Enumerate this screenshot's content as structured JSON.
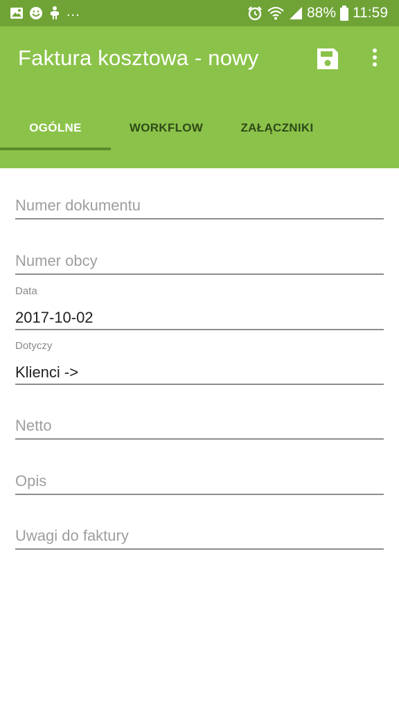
{
  "status_bar": {
    "left_icons": [
      "image-icon",
      "smiley-icon",
      "android-icon"
    ],
    "more": "...",
    "battery_percent": "88%",
    "time": "11:59"
  },
  "app_bar": {
    "title": "Faktura kosztowa - nowy",
    "color": "#8bc34a"
  },
  "tabs": [
    {
      "label": "OGÓLNE",
      "active": true
    },
    {
      "label": "WORKFLOW",
      "active": false
    },
    {
      "label": "ZAŁĄCZNIKI",
      "active": false
    }
  ],
  "form": {
    "numer_dokumentu": {
      "placeholder": "Numer dokumentu"
    },
    "numer_obcy": {
      "placeholder": "Numer obcy"
    },
    "data": {
      "label": "Data",
      "value": "2017-10-02"
    },
    "dotyczy": {
      "label": "Dotyczy",
      "value": "Klienci ->"
    },
    "netto": {
      "placeholder": "Netto"
    },
    "opis": {
      "placeholder": "Opis"
    },
    "uwagi": {
      "placeholder": "Uwagi do faktury"
    }
  }
}
